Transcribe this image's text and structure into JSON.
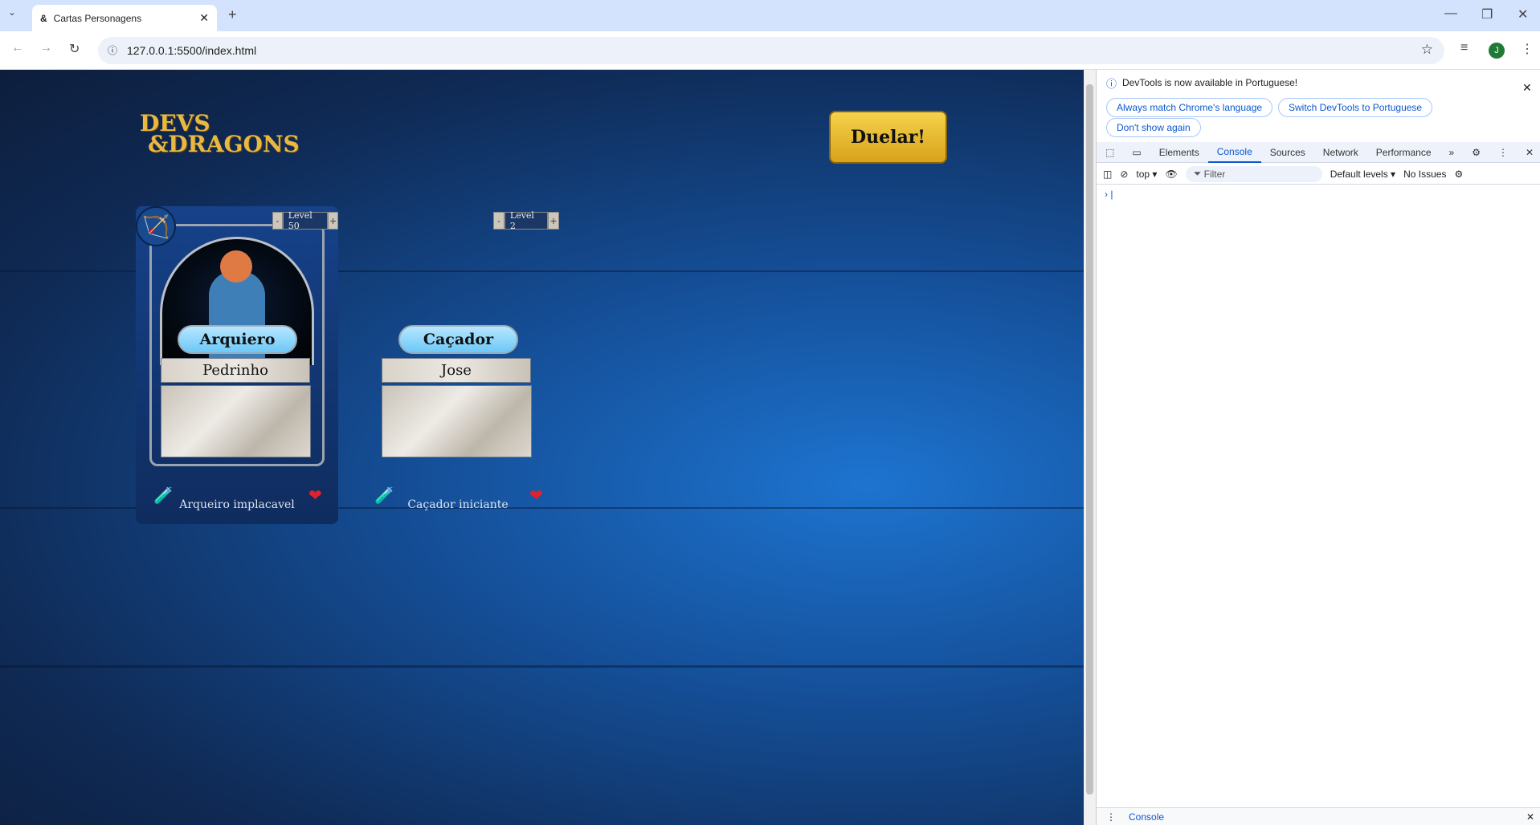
{
  "browser": {
    "tab_title": "Cartas Personagens",
    "url": "127.0.0.1:5500/index.html",
    "profile_initial": "J"
  },
  "page": {
    "logo": {
      "line1": "DEVS",
      "line2": "&DRAGONS"
    },
    "duel_button": "Duelar!",
    "cards": [
      {
        "level": "Level 50",
        "class": "Arquiero",
        "name": "Pedrinho",
        "description": "",
        "footer": "Arqueiro implacavel",
        "filled": true
      },
      {
        "level": "Level 2",
        "class": "Caçador",
        "name": "Jose",
        "description": "",
        "footer": "Caçador iniciante",
        "filled": false
      }
    ],
    "level_minus": "-",
    "level_plus": "+"
  },
  "devtools": {
    "info": "DevTools is now available in Portuguese!",
    "buttons": [
      "Always match Chrome's language",
      "Switch DevTools to Portuguese",
      "Don't show again"
    ],
    "tabs": [
      "Elements",
      "Console",
      "Sources",
      "Network",
      "Performance"
    ],
    "active_tab": "Console",
    "context": "top ▾",
    "filter_placeholder": "Filter",
    "levels": "Default levels ▾",
    "issues": "No Issues",
    "drawer_tab": "Console"
  }
}
